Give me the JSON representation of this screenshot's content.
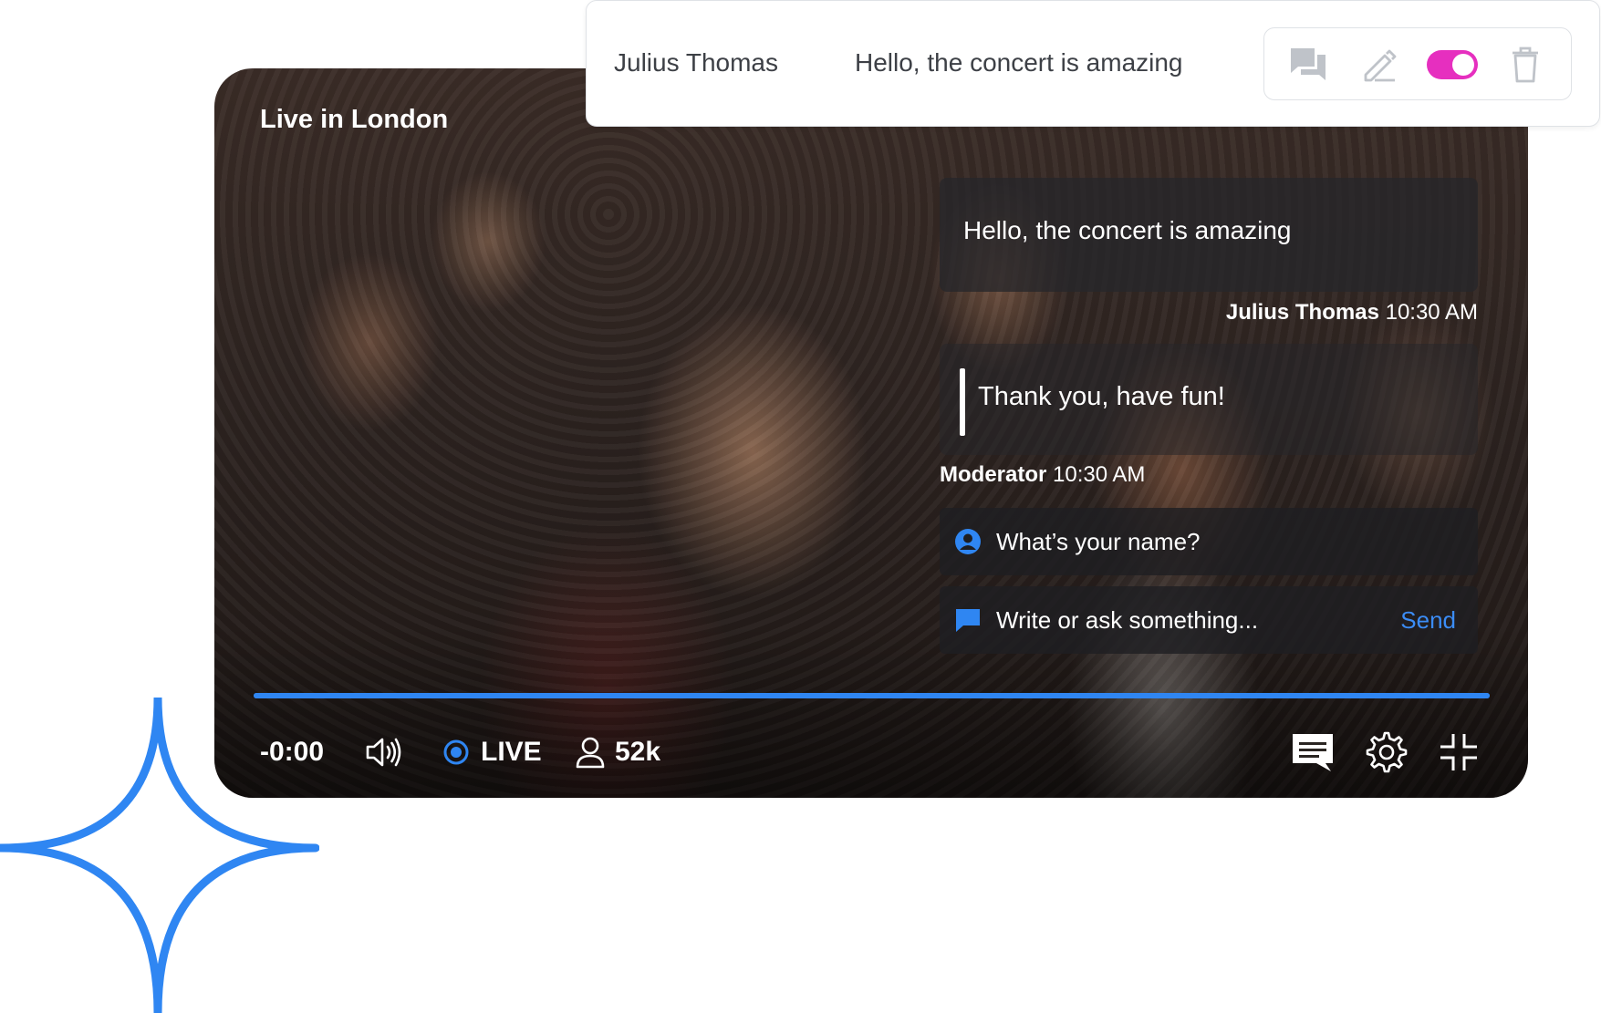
{
  "moderation": {
    "user": "Julius Thomas",
    "message": "Hello, the concert is amazing",
    "actions": {
      "reply_icon": "chat-bubbles-icon",
      "edit_icon": "pencil-icon",
      "toggle_on": true,
      "delete_icon": "trash-icon"
    },
    "toggle_color": "#e62fbf"
  },
  "player": {
    "title": "Live in London",
    "time": "-0:00",
    "live_label": "LIVE",
    "viewers": "52k",
    "progress": 1.0,
    "accent": "#2f86f2"
  },
  "chat": {
    "messages": [
      {
        "text": "Hello, the concert is amazing",
        "author": "Julius Thomas",
        "time": "10:30 AM"
      },
      {
        "text": "Thank you, have fun!",
        "author": "Moderator",
        "time": "10:30 AM"
      }
    ],
    "name_placeholder": "What’s your name?",
    "message_placeholder": "Write or ask something...",
    "send_label": "Send"
  }
}
